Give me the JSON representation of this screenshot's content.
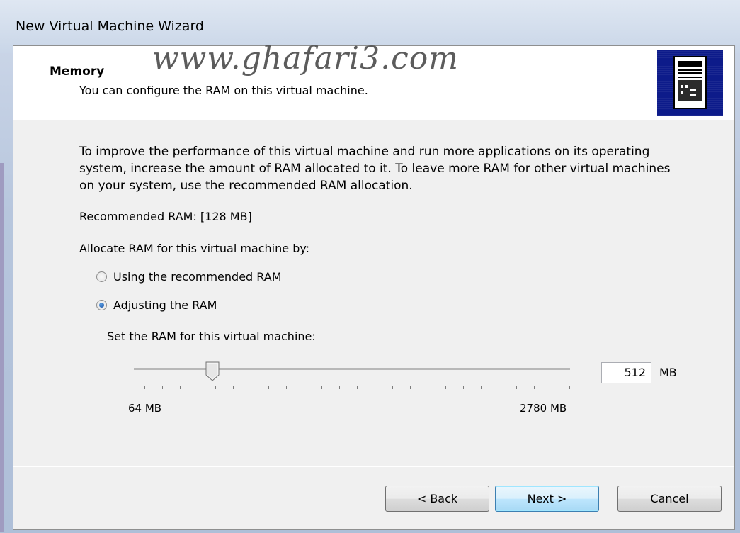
{
  "window": {
    "title": "New Virtual Machine Wizard",
    "watermark": "www.ghafari3.com"
  },
  "header": {
    "title": "Memory",
    "subtitle": "You can configure the RAM on this virtual machine.",
    "icon": "server-tower-icon"
  },
  "content": {
    "description": "To improve the performance of this virtual machine and run more applications on its operating system, increase the amount of RAM allocated to it. To leave more RAM for other virtual machines on your system, use the recommended RAM allocation.",
    "recommended": "Recommended RAM: [128 MB]",
    "allocate_label": "Allocate RAM for this virtual machine by:",
    "options": [
      {
        "label": "Using the recommended RAM",
        "checked": false
      },
      {
        "label": "Adjusting the RAM",
        "checked": true
      }
    ],
    "set_label": "Set the RAM for this virtual machine:",
    "slider": {
      "min_label": "64 MB",
      "max_label": "2780 MB",
      "value_mb": 512,
      "tick_count": 25
    },
    "ram_value": "512",
    "ram_unit": "MB"
  },
  "buttons": {
    "back": "< Back",
    "next": "Next >",
    "cancel": "Cancel"
  }
}
